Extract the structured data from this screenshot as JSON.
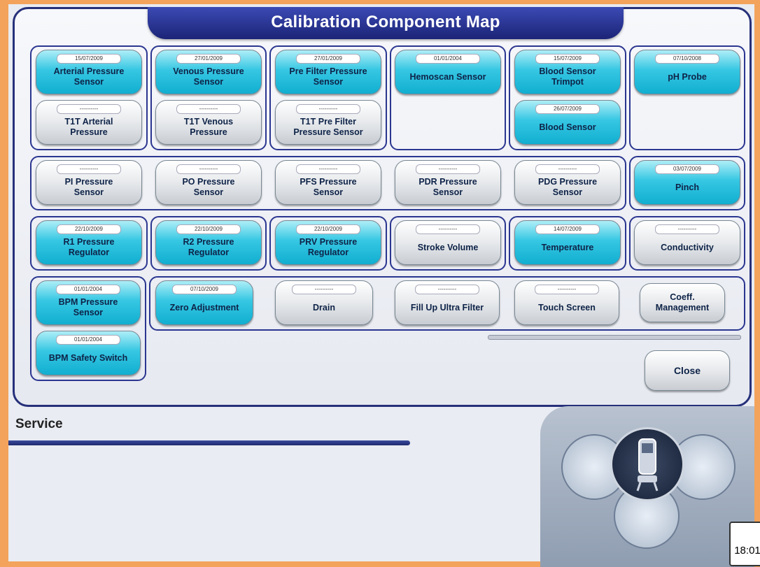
{
  "title": "Calibration Component Map",
  "section_label": "Service",
  "close_label": "Close",
  "clock": "18:01",
  "buttons": {
    "arterial_pressure": {
      "date": "15/07/2009",
      "label1": "Arterial Pressure",
      "label2": "Sensor"
    },
    "t1t_arterial": {
      "date": "----------",
      "label1": "T1T Arterial",
      "label2": "Pressure"
    },
    "venous_pressure": {
      "date": "27/01/2009",
      "label1": "Venous Pressure",
      "label2": "Sensor"
    },
    "t1t_venous": {
      "date": "----------",
      "label1": "T1T Venous",
      "label2": "Pressure"
    },
    "pre_filter": {
      "date": "27/01/2009",
      "label1": "Pre Filter Pressure",
      "label2": "Sensor"
    },
    "t1t_pre_filter": {
      "date": "----------",
      "label1": "T1T Pre Filter",
      "label2": "Pressure Sensor"
    },
    "hemoscan": {
      "date": "01/01/2004",
      "label1": "Hemoscan Sensor",
      "label2": ""
    },
    "blood_sensor_trimpot": {
      "date": "15/07/2009",
      "label1": "Blood Sensor",
      "label2": "Trimpot"
    },
    "blood_sensor": {
      "date": "26/07/2009",
      "label1": "Blood Sensor",
      "label2": ""
    },
    "ph_probe": {
      "date": "07/10/2008",
      "label1": "pH Probe",
      "label2": ""
    },
    "pi_pressure": {
      "date": "----------",
      "label1": "PI Pressure",
      "label2": "Sensor"
    },
    "po_pressure": {
      "date": "----------",
      "label1": "PO Pressure",
      "label2": "Sensor"
    },
    "pfs_pressure": {
      "date": "----------",
      "label1": "PFS Pressure",
      "label2": "Sensor"
    },
    "pdr_pressure": {
      "date": "----------",
      "label1": "PDR Pressure",
      "label2": "Sensor"
    },
    "pdg_pressure": {
      "date": "----------",
      "label1": "PDG Pressure",
      "label2": "Sensor"
    },
    "pinch": {
      "date": "03/07/2009",
      "label1": "Pinch",
      "label2": ""
    },
    "r1_pressure": {
      "date": "22/10/2009",
      "label1": "R1 Pressure",
      "label2": "Regulator"
    },
    "r2_pressure": {
      "date": "22/10/2009",
      "label1": "R2 Pressure",
      "label2": "Regulator"
    },
    "prv_pressure": {
      "date": "22/10/2009",
      "label1": "PRV Pressure",
      "label2": "Regulator"
    },
    "stroke_volume": {
      "date": "----------",
      "label1": "Stroke Volume",
      "label2": ""
    },
    "temperature": {
      "date": "14/07/2009",
      "label1": "Temperature",
      "label2": ""
    },
    "conductivity": {
      "date": "----------",
      "label1": "Conductivity",
      "label2": ""
    },
    "bpm_pressure": {
      "date": "01/01/2004",
      "label1": "BPM Pressure",
      "label2": "Sensor"
    },
    "bpm_safety": {
      "date": "01/01/2004",
      "label1": "BPM Safety Switch",
      "label2": ""
    },
    "zero_adjustment": {
      "date": "07/10/2009",
      "label1": "Zero Adjustment",
      "label2": ""
    },
    "drain": {
      "date": "----------",
      "label1": "Drain",
      "label2": ""
    },
    "fill_up_ultra_filter": {
      "date": "----------",
      "label1": "Fill Up Ultra Filter",
      "label2": ""
    },
    "touch_screen": {
      "date": "----------",
      "label1": "Touch Screen",
      "label2": ""
    },
    "coeff_management": {
      "label1": "Coeff.",
      "label2": "Management"
    }
  },
  "colors": {
    "calibrated": "#1bb8d8",
    "not_calibrated": "#e4e6ea",
    "frame": "#26307a"
  }
}
